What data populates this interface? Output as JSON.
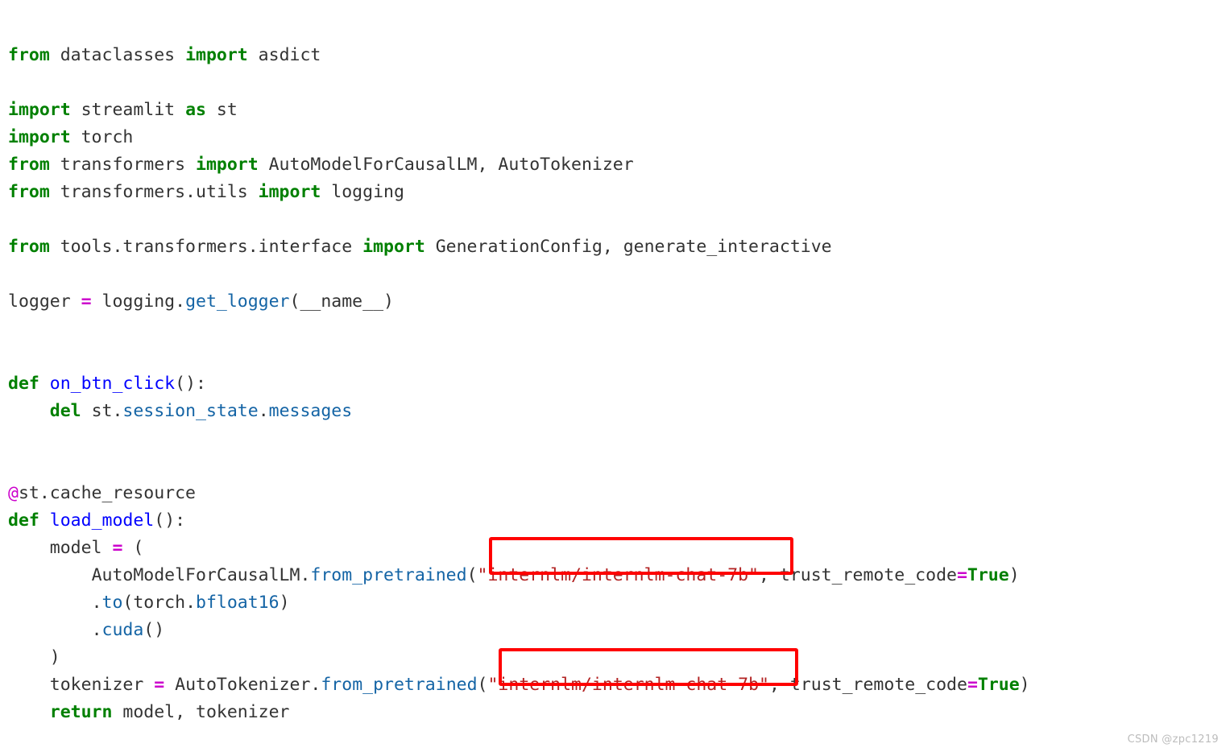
{
  "document": {
    "kind": "python-source-screenshot",
    "language": "Python",
    "watermark": "CSDN @zpc1219"
  },
  "colors": {
    "background": "#ffffff",
    "keyword": "#008000",
    "plain_text": "#333333",
    "def_name": "#0000ff",
    "attribute": "#1464a5",
    "operator": "#cc00cc",
    "decorator": "#cc00cc",
    "string": "#b22222",
    "annotation_box": "#ff0000",
    "watermark": "#bcbcbc"
  },
  "code": {
    "lines": [
      {
        "n": 1,
        "text": "from dataclasses import asdict"
      },
      {
        "n": 2,
        "text": ""
      },
      {
        "n": 3,
        "text": "import streamlit as st"
      },
      {
        "n": 4,
        "text": "import torch"
      },
      {
        "n": 5,
        "text": "from transformers import AutoModelForCausalLM, AutoTokenizer"
      },
      {
        "n": 6,
        "text": "from transformers.utils import logging"
      },
      {
        "n": 7,
        "text": ""
      },
      {
        "n": 8,
        "text": "from tools.transformers.interface import GenerationConfig, generate_interactive"
      },
      {
        "n": 9,
        "text": ""
      },
      {
        "n": 10,
        "text": "logger = logging.get_logger(__name__)"
      },
      {
        "n": 11,
        "text": ""
      },
      {
        "n": 12,
        "text": ""
      },
      {
        "n": 13,
        "text": "def on_btn_click():"
      },
      {
        "n": 14,
        "text": "    del st.session_state.messages"
      },
      {
        "n": 15,
        "text": ""
      },
      {
        "n": 16,
        "text": ""
      },
      {
        "n": 17,
        "text": "@st.cache_resource"
      },
      {
        "n": 18,
        "text": "def load_model():"
      },
      {
        "n": 19,
        "text": "    model = ("
      },
      {
        "n": 20,
        "text": "        AutoModelForCausalLM.from_pretrained(\"internlm/internlm-chat-7b\", trust_remote_code=True)"
      },
      {
        "n": 21,
        "text": "        .to(torch.bfloat16)"
      },
      {
        "n": 22,
        "text": "        .cuda()"
      },
      {
        "n": 23,
        "text": "    )"
      },
      {
        "n": 24,
        "text": "    tokenizer = AutoTokenizer.from_pretrained(\"internlm/internlm-chat-7b\", trust_remote_code=True)"
      },
      {
        "n": 25,
        "text": "    return model, tokenizer"
      }
    ],
    "tokens": {
      "kw_from": "from",
      "kw_import": "import",
      "kw_as": "as",
      "kw_def": "def",
      "kw_del": "del",
      "kw_return": "return",
      "kw_true": "True",
      "mod_dataclasses": " dataclasses ",
      "name_asdict": " asdict",
      "mod_streamlit": " streamlit ",
      "alias_st": " st",
      "mod_torch": " torch",
      "mod_transformers": " transformers ",
      "names_transformers": " AutoModelForCausalLM, AutoTokenizer",
      "mod_transformers_utils": " transformers.utils ",
      "name_logging": " logging",
      "mod_tools_interface": " tools.transformers.interface ",
      "names_interface": " GenerationConfig, generate_interactive",
      "logger_var": "logger ",
      "eq": "=",
      "logging_dot": " logging.",
      "get_logger": "get_logger",
      "name_dunder_arg": "(__name__)",
      "fn_on_btn_click": "on_btn_click",
      "parens_colon": "():",
      "indent4": "    ",
      "indent8": "        ",
      "st_dot": " st.",
      "session_state": "session_state",
      "dot": ".",
      "messages": "messages",
      "at": "@",
      "st_cache_resource": "st.cache_resource",
      "fn_load_model": "load_model",
      "var_model": "model ",
      "open_paren": " (",
      "cls_automodel": "AutoModelForCausalLM.",
      "from_pretrained": "from_pretrained",
      "lparen": "(",
      "model_string": "\"internlm/internlm-chat-7b\"",
      "comma_space": ", ",
      "trust_remote_code": "trust_remote_code",
      "rparen": ")",
      "dot_to": ".",
      "to": "to",
      "torch_arg": "(torch.",
      "bfloat16": "bfloat16",
      "cuda": "cuda",
      "empty_call": "()",
      "close_paren": ")",
      "var_tokenizer": "tokenizer ",
      "cls_autotokenizer": " AutoTokenizer.",
      "ret_vals": " model, tokenizer"
    }
  },
  "annotations": {
    "boxes": [
      {
        "id": "highlight-model-name-1",
        "label": "\"internlm/internlm-chat-7b\"",
        "line": 20,
        "color": "#ff0000"
      },
      {
        "id": "highlight-model-name-2",
        "label": "\"internlm/internlm-chat-7b\"",
        "line": 24,
        "color": "#ff0000"
      }
    ]
  }
}
